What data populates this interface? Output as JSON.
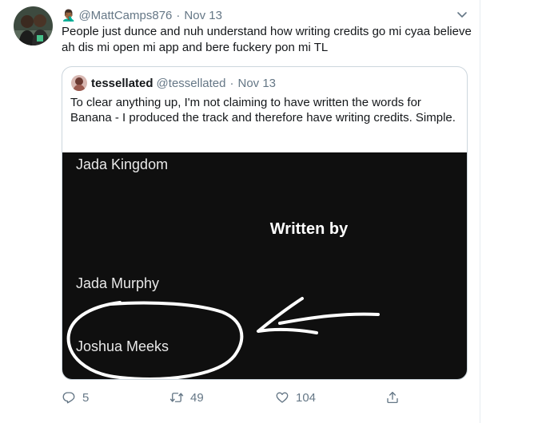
{
  "tweet": {
    "author_emoji": "🤦🏾‍♂️",
    "handle": "@MattCamps876",
    "separator": "·",
    "date": "Nov 13",
    "text": "People just dunce and nuh understand how writing credits go mi cyaa believe ah dis mi open mi app and bere fuckery pon mi TL"
  },
  "quoted_tweet": {
    "display_name": "tessellated",
    "handle": "@tessellated",
    "separator": "·",
    "date": "Nov 13",
    "text": "To clear anything up, I'm not claiming to have written the words for Banana - I produced the track and therefore have writing credits. Simple.",
    "media": {
      "artist": "Jada Kingdom",
      "heading": "Written by",
      "names": [
        "Jada Murphy",
        "Joshua Meeks"
      ]
    }
  },
  "actions": {
    "replies": "5",
    "retweets": "49",
    "likes": "104"
  },
  "icons": {
    "reply": "reply-icon",
    "retweet": "retweet-icon",
    "like": "heart-icon",
    "share": "share-icon",
    "caret": "chevron-down-icon"
  },
  "colors": {
    "muted": "#657786",
    "text": "#14171a",
    "border": "#ccd6dd",
    "media_bg": "#0f0f0f"
  }
}
